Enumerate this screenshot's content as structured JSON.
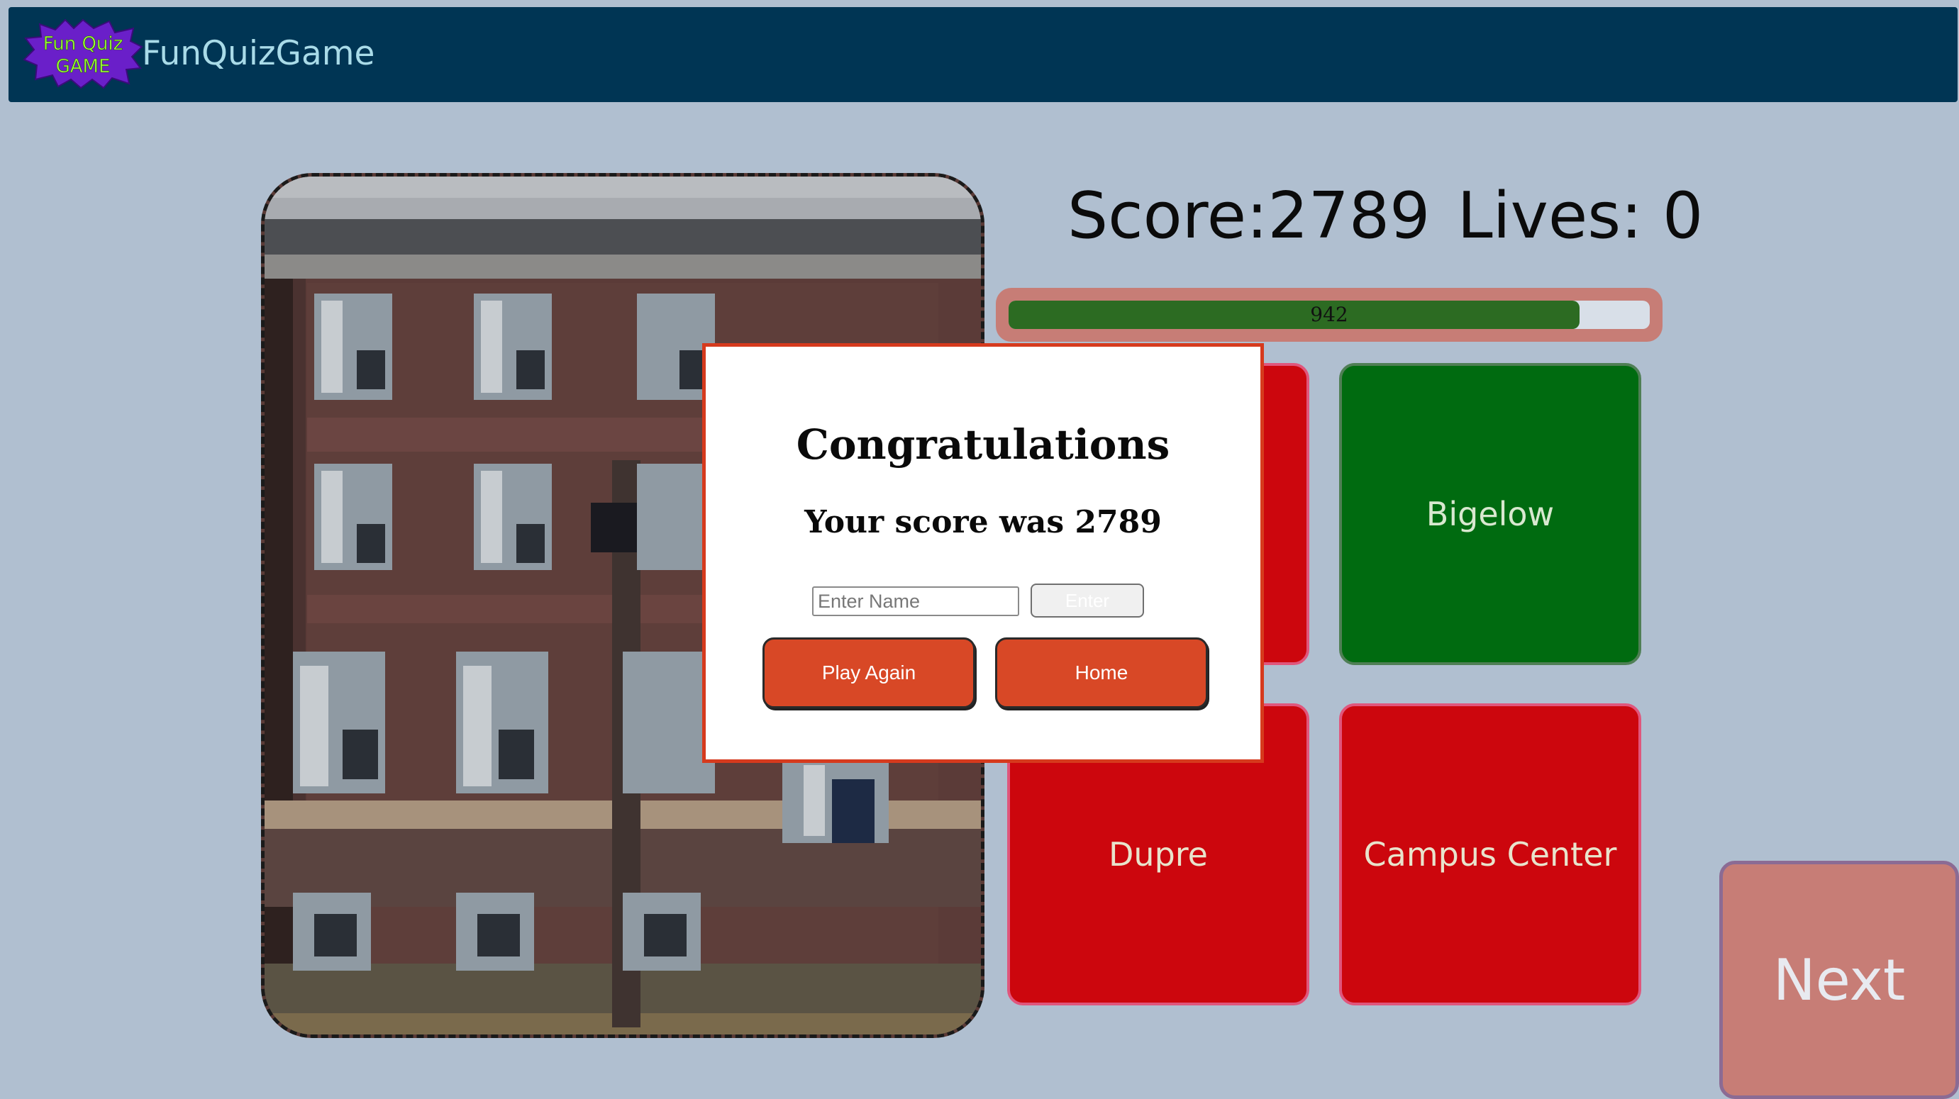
{
  "header": {
    "logo_text": "Fun Quiz GAME",
    "brand": "FunQuizGame"
  },
  "status": {
    "score_text": "Score:2789",
    "lives_text": "Lives: 0",
    "timer_value": 942,
    "timer_fraction": 0.89
  },
  "answers": [
    {
      "label": "",
      "state": "wrong"
    },
    {
      "label": "Bigelow",
      "state": "correct"
    },
    {
      "label": "Dupre",
      "state": "wrong"
    },
    {
      "label": "Campus Center",
      "state": "wrong"
    }
  ],
  "next_label": "Next",
  "modal": {
    "title": "Congratulations",
    "subtitle": "Your score was 2789",
    "name_placeholder": "Enter Name",
    "enter_label": "Enter",
    "play_again_label": "Play Again",
    "home_label": "Home"
  },
  "colors": {
    "background": "#b0bfd0",
    "navbar": "#003554",
    "wrong_answer": "#cc060d",
    "correct_answer": "#006b10",
    "timer_fill": "#2c6b22",
    "modal_accent": "#d63a1d"
  },
  "icons": {
    "logo": "fun-quiz-game-starburst-logo"
  }
}
